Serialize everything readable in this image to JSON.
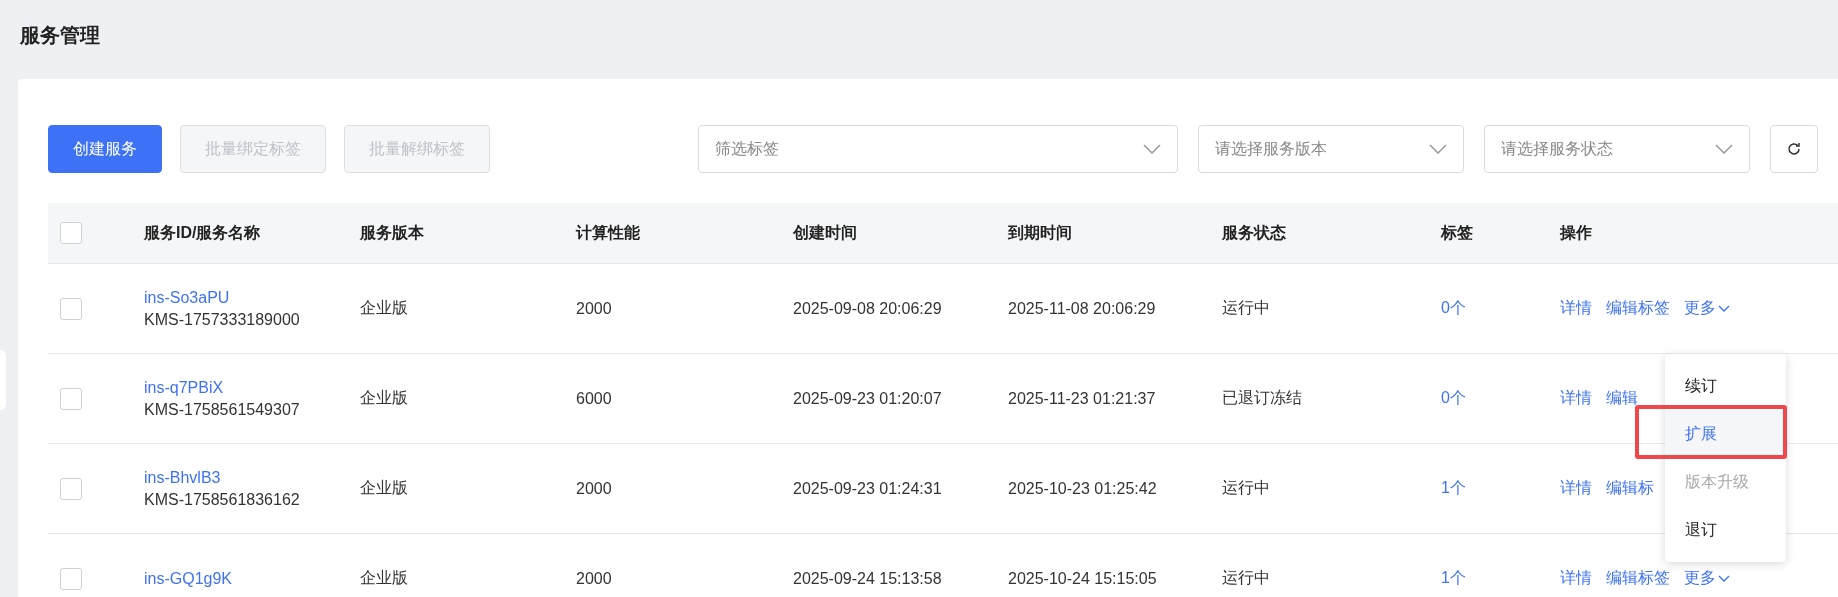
{
  "page": {
    "title": "服务管理"
  },
  "toolbar": {
    "buttons": [
      {
        "label": "创建服务",
        "kind": "primary",
        "disabled": false
      },
      {
        "label": "批量绑定标签",
        "kind": "default",
        "disabled": true
      },
      {
        "label": "批量解绑标签",
        "kind": "default",
        "disabled": true
      }
    ],
    "filters": [
      {
        "placeholder": "筛选标签",
        "kind": "wide"
      },
      {
        "placeholder": "请选择服务版本",
        "kind": "normal"
      },
      {
        "placeholder": "请选择服务状态",
        "kind": "normal"
      }
    ]
  },
  "table": {
    "columns": [
      "服务ID/服务名称",
      "服务版本",
      "计算性能",
      "创建时间",
      "到期时间",
      "服务状态",
      "标签",
      "操作"
    ],
    "header_checked": false,
    "rows": [
      {
        "checked": false,
        "id": "ins-So3aPU",
        "name": "KMS-1757333189000",
        "version": "企业版",
        "performance": "2000",
        "created": "2025-09-08 20:06:29",
        "expires": "2025-11-08 20:06:29",
        "status": "运行中",
        "tags": "0个",
        "actions": [
          "详情",
          "编辑标签",
          "更多"
        ]
      },
      {
        "checked": false,
        "id": "ins-q7PBiX",
        "name": "KMS-1758561549307",
        "version": "企业版",
        "performance": "6000",
        "created": "2025-09-23 01:20:07",
        "expires": "2025-11-23 01:21:37",
        "status": "已退订冻结",
        "tags": "0个",
        "actions": [
          "详情",
          "编辑"
        ]
      },
      {
        "checked": false,
        "id": "ins-BhvlB3",
        "name": "KMS-1758561836162",
        "version": "企业版",
        "performance": "2000",
        "created": "2025-09-23 01:24:31",
        "expires": "2025-10-23 01:25:42",
        "status": "运行中",
        "tags": "1个",
        "actions": [
          "详情",
          "编辑标"
        ]
      },
      {
        "checked": false,
        "id": "ins-GQ1g9K",
        "version": "企业版",
        "performance": "2000",
        "created": "2025-09-24 15:13:58",
        "expires": "2025-10-24 15:15:05",
        "status": "运行中",
        "tags": "1个",
        "actions": [
          "详情",
          "编辑标签",
          "更多"
        ]
      }
    ]
  },
  "more_menu": {
    "items": [
      {
        "label": "续订",
        "selected": false,
        "disabled": false
      },
      {
        "label": "扩展",
        "selected": true,
        "disabled": false
      },
      {
        "label": "版本升级",
        "selected": false,
        "disabled": true
      },
      {
        "label": "退订",
        "selected": false,
        "disabled": false
      }
    ]
  }
}
